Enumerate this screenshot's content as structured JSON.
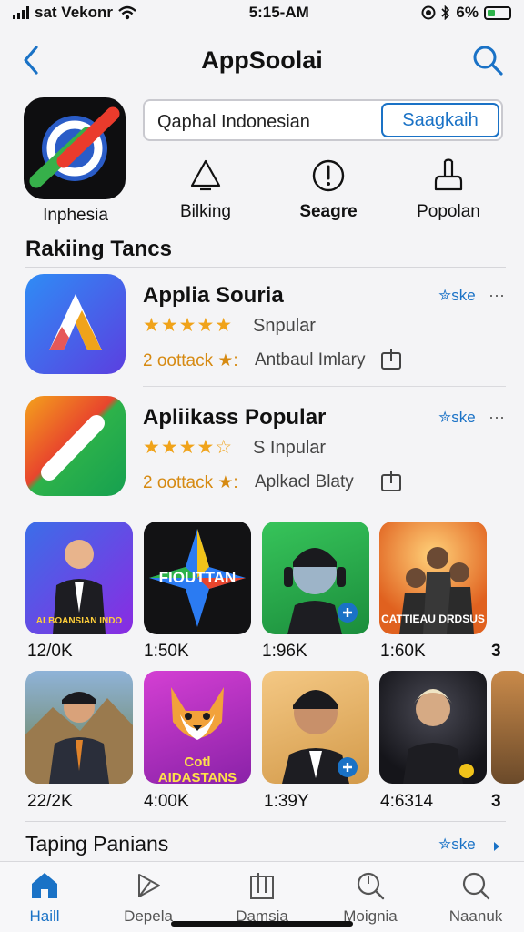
{
  "status": {
    "carrier": "sat Vekonr",
    "time": "5:15-AM",
    "battery": "6%"
  },
  "header": {
    "title": "AppSoolai"
  },
  "hero": {
    "app_label": "Inphesia",
    "search_value": "Qaphal Indonesian",
    "search_button": "Saagkaih",
    "quick_actions": [
      {
        "label": "Bilking",
        "icon": "warning-icon"
      },
      {
        "label": "Seagre",
        "icon": "alert-circle-icon"
      },
      {
        "label": "Popolan",
        "icon": "thumbs-up-icon"
      }
    ]
  },
  "ranking": {
    "title": "Rakiing Tancs",
    "apps": [
      {
        "name": "Applia Souria",
        "stars": "★★★★★",
        "rating_label": "Snpular",
        "downloads": "2 oottack ★:",
        "category": "Antbaul Imlary",
        "get_label": "✮ske",
        "more": "···",
        "colors": [
          "#2f7af0",
          "#6a3be0"
        ]
      },
      {
        "name": "Apliikass Popular",
        "stars": "★★★★☆",
        "rating_label": "S Inpular",
        "downloads": "2 oottack ★:",
        "category": "Aplkacl Blaty",
        "get_label": "✮ske",
        "more": "···",
        "colors": [
          "#f4a21c",
          "#2db24a"
        ]
      }
    ]
  },
  "grid": {
    "row1": [
      {
        "count": "12/0K",
        "caption": "ALBOANSIAN INDO",
        "bg": "#5a3fc4"
      },
      {
        "count": "1:50K",
        "caption": "FIOUTTAN",
        "bg": "#121214"
      },
      {
        "count": "1:96K",
        "caption": "",
        "bg": "#2bb04a"
      },
      {
        "count": "1:60K",
        "caption": "CATTIEAU DRDSUS",
        "bg": "#e67a2a"
      }
    ],
    "row1_edge": "3",
    "row2": [
      {
        "count": "22/2K",
        "caption": "",
        "bg": "#5d7fa6"
      },
      {
        "count": "4:00K",
        "caption": "Cotl AIDASTANS",
        "bg": "#b02fb9"
      },
      {
        "count": "1:39Y",
        "caption": "",
        "bg": "#e3b06a"
      },
      {
        "count": "4:6314",
        "caption": "",
        "bg": "#1f1f24"
      }
    ],
    "row2_edge": "3"
  },
  "footer_section": {
    "title": "Taping Panians",
    "link": "✮ske"
  },
  "tabs": [
    {
      "label": "Haill",
      "icon": "home-icon",
      "active": true
    },
    {
      "label": "Depela",
      "icon": "pen-icon",
      "active": false
    },
    {
      "label": "Damsia",
      "icon": "bookmark-icon",
      "active": false
    },
    {
      "label": "Moignia",
      "icon": "search-icon",
      "active": false
    },
    {
      "label": "Naanuk",
      "icon": "search-icon",
      "active": false
    }
  ]
}
